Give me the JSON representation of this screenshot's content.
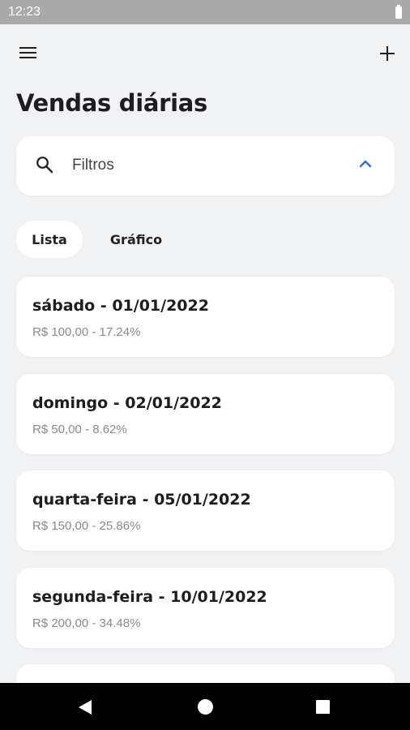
{
  "status_bar": {
    "time": "12:23"
  },
  "app_bar": {
    "menu_icon": "menu-icon",
    "add_icon": "add-icon"
  },
  "page": {
    "title": "Vendas diárias"
  },
  "filter": {
    "label": "Filtros",
    "icon": "search-icon",
    "expand_icon": "chevron-up-icon",
    "accent": "#2f6fd6"
  },
  "tabs": [
    {
      "label": "Lista",
      "selected": true
    },
    {
      "label": "Gráfico",
      "selected": false
    }
  ],
  "sales": [
    {
      "title": "sábado - 01/01/2022",
      "subtitle": "R$ 100,00 - 17.24%"
    },
    {
      "title": "domingo - 02/01/2022",
      "subtitle": "R$ 50,00 - 8.62%"
    },
    {
      "title": "quarta-feira - 05/01/2022",
      "subtitle": "R$ 150,00 - 25.86%"
    },
    {
      "title": "segunda-feira - 10/01/2022",
      "subtitle": "R$ 200,00 - 34.48%"
    }
  ],
  "nav_bar": {
    "back_icon": "back-triangle-icon",
    "home_icon": "home-circle-icon",
    "recents_icon": "recents-square-icon"
  }
}
